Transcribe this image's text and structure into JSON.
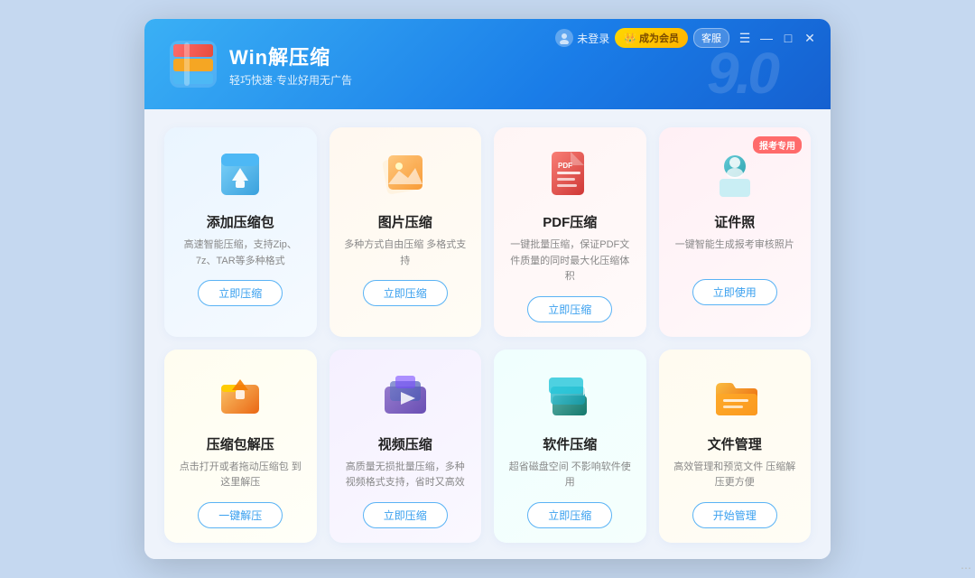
{
  "app": {
    "title": "Win解压缩",
    "subtitle": "轻巧快速·专业好用无广告",
    "version": "9.0"
  },
  "header": {
    "user_label": "未登录",
    "vip_label": "成为会员",
    "guest_label": "客服",
    "menu_label": "☰",
    "min_label": "—",
    "max_label": "□",
    "close_label": "✕"
  },
  "cards": [
    {
      "id": "add-zip",
      "title": "添加压缩包",
      "desc": "高速智能压缩，支持Zip、7z、TAR等多种格式",
      "btn": "立即压缩",
      "bg": "card-blue",
      "badge": null,
      "icon_color": "#4db8f5"
    },
    {
      "id": "image-compress",
      "title": "图片压缩",
      "desc": "多种方式自由压缩 多格式支持",
      "btn": "立即压缩",
      "bg": "card-orange",
      "badge": null,
      "icon_color": "#f5a623"
    },
    {
      "id": "pdf-compress",
      "title": "PDF压缩",
      "desc": "一键批量压缩，保证PDF文件质量的同时最大化压缩体积",
      "btn": "立即压缩",
      "bg": "card-red",
      "badge": null,
      "icon_color": "#e74c3c"
    },
    {
      "id": "id-photo",
      "title": "证件照",
      "desc": "一键智能生成报考审核照片",
      "btn": "立即使用",
      "bg": "card-pink",
      "badge": "报考专用",
      "icon_color": "#5bb8d4"
    },
    {
      "id": "unzip",
      "title": "压缩包解压",
      "desc": "点击打开或者拖动压缩包 到这里解压",
      "btn": "一键解压",
      "bg": "card-yellow",
      "badge": null,
      "icon_color": "#f5a623"
    },
    {
      "id": "video-compress",
      "title": "视频压缩",
      "desc": "高质量无损批量压缩，多种视频格式支持，省时又高效",
      "btn": "立即压缩",
      "bg": "card-purple",
      "badge": null,
      "icon_color": "#6b5cdb"
    },
    {
      "id": "soft-compress",
      "title": "软件压缩",
      "desc": "超省磁盘空间 不影响软件使用",
      "btn": "立即压缩",
      "bg": "card-teal",
      "badge": null,
      "icon_color": "#2ec4b6"
    },
    {
      "id": "file-manage",
      "title": "文件管理",
      "desc": "高效管理和预览文件 压缩解压更方便",
      "btn": "开始管理",
      "bg": "card-amber",
      "badge": null,
      "icon_color": "#f5a623"
    }
  ]
}
